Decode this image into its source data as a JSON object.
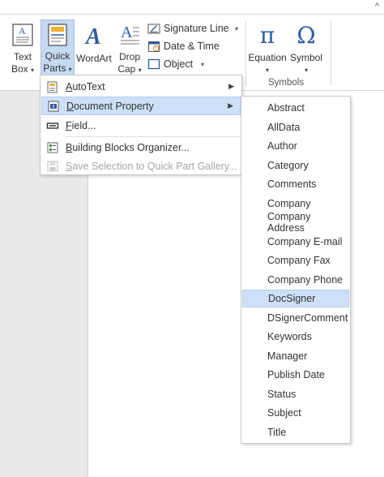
{
  "ribbon": {
    "text_box": {
      "line1": "Text",
      "line2": "Box",
      "icon": "text-box-icon"
    },
    "quick_parts": {
      "line1": "Quick",
      "line2": "Parts",
      "icon": "quick-parts-icon"
    },
    "wordart": {
      "label": "WordArt",
      "icon": "wordart-icon"
    },
    "drop_cap": {
      "line1": "Drop",
      "line2": "Cap",
      "icon": "drop-cap-icon"
    },
    "signature_line": {
      "label": "Signature Line",
      "icon": "signature-line-icon"
    },
    "date_time": {
      "label": "Date & Time",
      "icon": "calendar-icon"
    },
    "object": {
      "label": "Object",
      "icon": "object-icon"
    },
    "equation": {
      "label": "Equation",
      "glyph": "π",
      "icon": "pi-icon"
    },
    "symbol": {
      "label": "Symbol",
      "glyph": "Ω",
      "icon": "omega-icon"
    },
    "symbols_group_label": "Symbols",
    "collapse_glyph": "^"
  },
  "quick_parts_menu": {
    "items": [
      {
        "label": "AutoText",
        "icon": "autotext-icon",
        "submenu": true
      },
      {
        "label": "Document Property",
        "icon": "document-property-icon",
        "submenu": true
      },
      {
        "label": "Field...",
        "icon": "field-icon",
        "submenu": false
      },
      {
        "label": "Building Blocks Organizer...",
        "icon": "building-blocks-icon",
        "submenu": false
      },
      {
        "label": "Save Selection to Quick Part Gallery...",
        "icon": "save-selection-icon",
        "submenu": false,
        "disabled": true
      }
    ]
  },
  "document_property_submenu": {
    "items": [
      "Abstract",
      "AllData",
      "Author",
      "Category",
      "Comments",
      "Company",
      "Company Address",
      "Company E-mail",
      "Company Fax",
      "Company Phone",
      "DocSigner",
      "DSignerComment",
      "Keywords",
      "Manager",
      "Publish Date",
      "Status",
      "Subject",
      "Title"
    ],
    "highlighted": "DocSigner"
  },
  "colors": {
    "accent_blue": "#2e5d9f",
    "hover_fill": "#cde0f7",
    "hover_border": "#b5cfee",
    "active_fill": "#c5d9f1"
  }
}
